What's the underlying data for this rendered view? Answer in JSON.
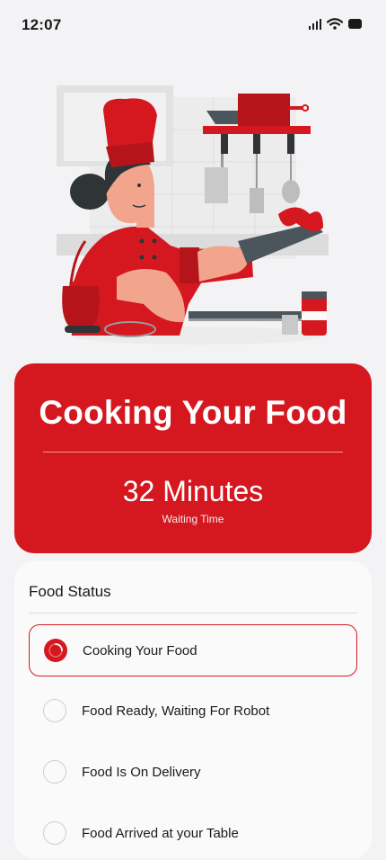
{
  "status_bar": {
    "time": "12:07"
  },
  "illustration": {
    "name": "chef cooking illustration"
  },
  "waiting_card": {
    "title": "Cooking Your Food",
    "time_value": "32 Minutes",
    "time_label": "Waiting Time"
  },
  "food_status": {
    "heading": "Food Status",
    "steps": [
      {
        "label": "Cooking Your Food",
        "active": true
      },
      {
        "label": "Food Ready, Waiting For Robot",
        "active": false
      },
      {
        "label": "Food Is On Delivery",
        "active": false
      },
      {
        "label": "Food Arrived at your Table",
        "active": false
      }
    ]
  },
  "colors": {
    "accent": "#d5181f",
    "background": "#f3f3f5",
    "card": "#fafafa"
  }
}
